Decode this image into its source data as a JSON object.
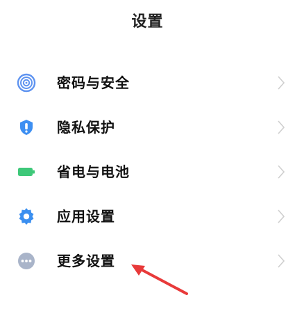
{
  "header": {
    "title": "设置"
  },
  "items": [
    {
      "label": "密码与安全",
      "icon": "fingerprint-icon",
      "color": "#5e93f0"
    },
    {
      "label": "隐私保护",
      "icon": "privacy-shield-icon",
      "color": "#3d8ff2"
    },
    {
      "label": "省电与电池",
      "icon": "battery-icon",
      "color": "#3ec879"
    },
    {
      "label": "应用设置",
      "icon": "gear-icon",
      "color": "#3a8ff0"
    },
    {
      "label": "更多设置",
      "icon": "more-icon",
      "color": "#a9b4c9"
    }
  ],
  "annotation": {
    "icon": "red-arrow-icon",
    "color": "#e83a3a"
  }
}
